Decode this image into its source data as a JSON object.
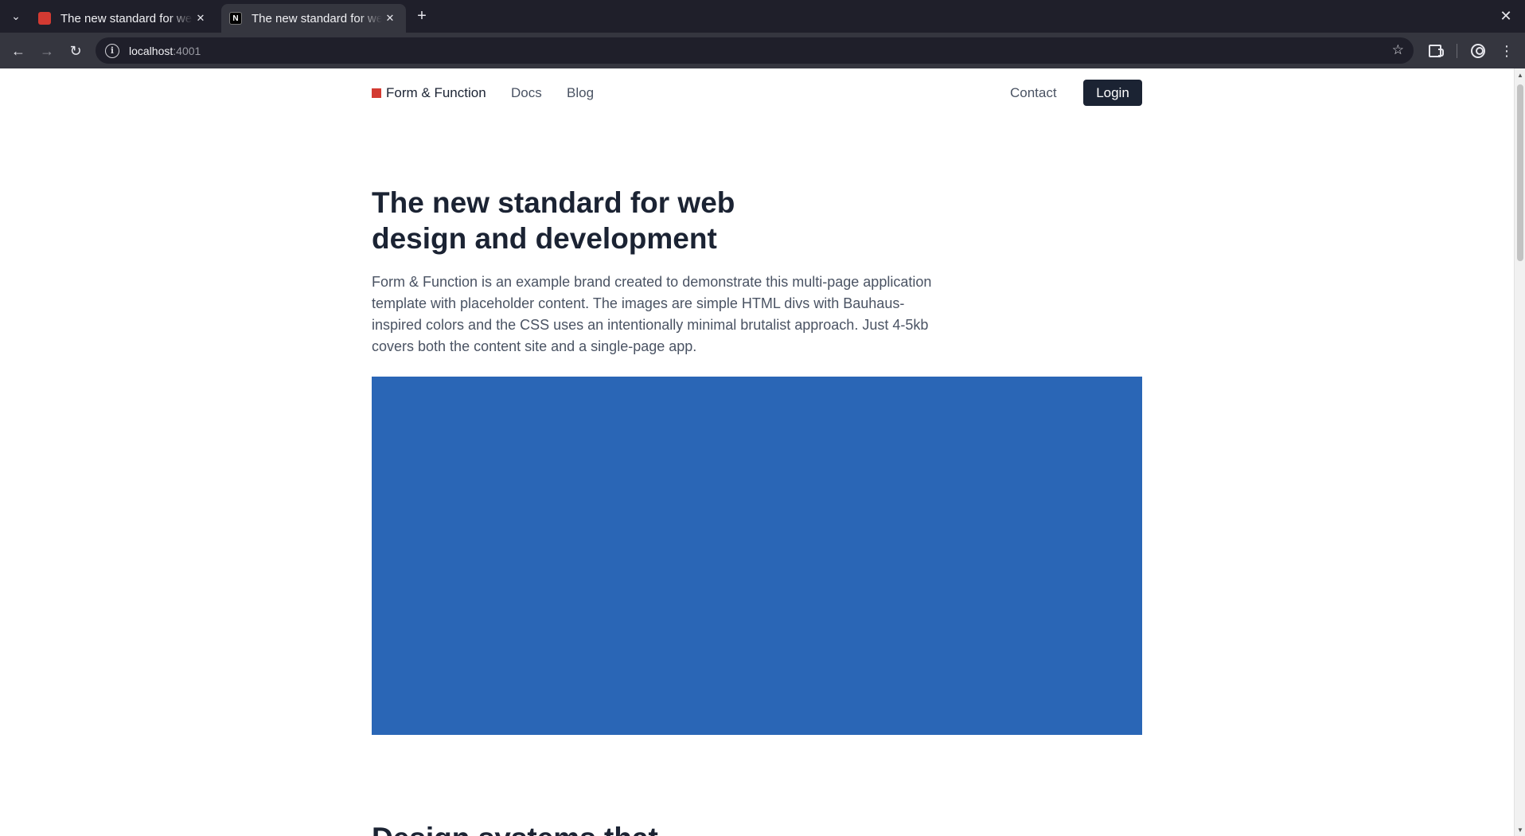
{
  "browser": {
    "tabs": [
      {
        "title": "The new standard for web design and development",
        "favicon": "red-square-favicon",
        "active": false
      },
      {
        "title": "The new standard for web design and development",
        "favicon": "n-letter-favicon",
        "favicon_text": "N",
        "active": true
      }
    ],
    "url_host": "localhost",
    "url_port": ":4001"
  },
  "site": {
    "brand": "Form & Function",
    "nav": {
      "docs": "Docs",
      "blog": "Blog",
      "contact": "Contact",
      "login": "Login"
    },
    "hero": {
      "title": "The new standard for web design and development",
      "body": "Form & Function is an example brand created to demonstrate this multi-page application template with placeholder content. The images are simple HTML divs with Bauhaus-inspired colors and the CSS uses an intentionally minimal brutalist approach. Just 4-5kb covers both the content site and a single-page app."
    },
    "next_heading": "Design systems that",
    "colors": {
      "brand_red": "#d33a32",
      "hero_blue": "#2a66b6",
      "ink": "#1b2333"
    }
  }
}
